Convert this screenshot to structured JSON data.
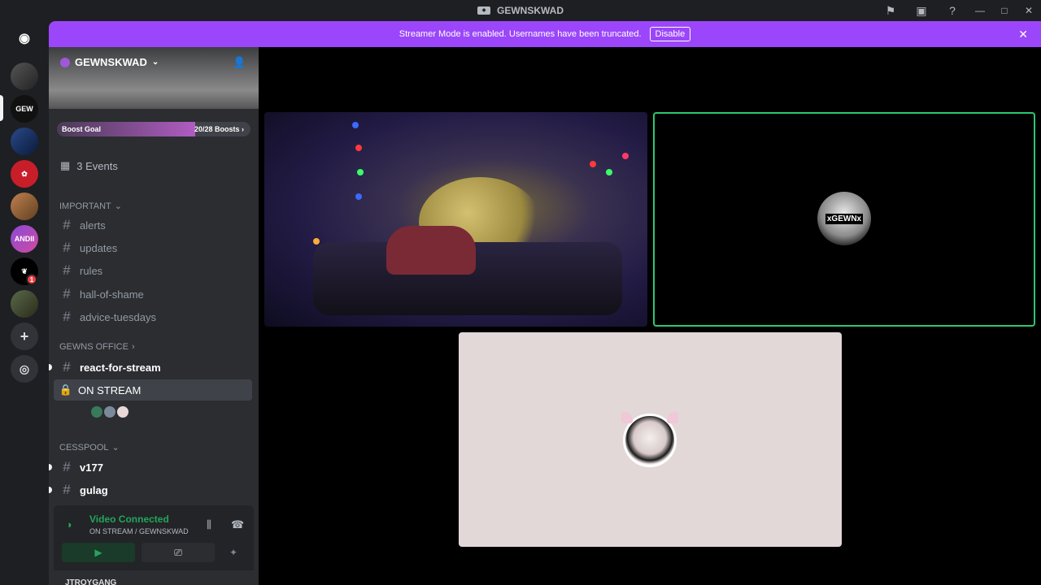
{
  "window": {
    "title": "GEWNSKWAD"
  },
  "banner": {
    "message": "Streamer Mode is enabled. Usernames have been truncated.",
    "button": "Disable"
  },
  "server": {
    "name": "GEWNSKWAD",
    "boost_label": "Boost Goal",
    "boost_count": "20/28 Boosts",
    "boost_progress": 0.714,
    "events": "3 Events"
  },
  "categories": {
    "important": "IMPORTANT",
    "office": "GEWNS OFFICE",
    "cesspool": "CESSPOOL"
  },
  "channels": {
    "alerts": "alerts",
    "updates": "updates",
    "rules": "rules",
    "hall": "hall-of-shame",
    "advice": "advice-tuesdays",
    "react": "react-for-stream",
    "onstream": "ON STREAM",
    "v177": "v177",
    "gulag": "gulag"
  },
  "voice_panel": {
    "status": "Video Connected",
    "location": "ON STREAM / GEWNSKWAD"
  },
  "user_peek": "JTROYGANG",
  "guild_badge": "1",
  "tiles": {
    "avatar1_text": "xGEWNx"
  },
  "colors": {
    "accent_purple": "#9b46fa",
    "connected_green": "#23a55a",
    "speaking_border": "#2dc770"
  }
}
